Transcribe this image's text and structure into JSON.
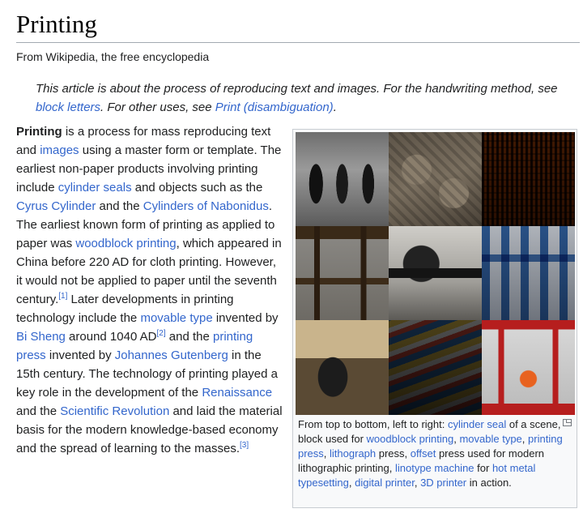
{
  "article": {
    "title": "Printing",
    "tagline": "From Wikipedia, the free encyclopedia"
  },
  "hatnote": {
    "t1": "This article is about the process of reproducing text and images. For the handwriting method, see ",
    "l1": "block letters",
    "t2": ". For other uses, see ",
    "l2": "Print (disambiguation)",
    "t3": "."
  },
  "lead": [
    "Printing",
    " is a process for mass reproducing text and ",
    "images",
    " using a master form or template. The earliest non-paper products involving printing include ",
    "cylinder seals",
    " and objects such as the ",
    "Cyrus Cylinder",
    " and the ",
    "Cylinders of Nabonidus",
    ". The earliest known form of printing as applied to paper was ",
    "woodblock printing",
    ", which appeared in China before 220 AD for cloth printing. However, it would not be applied to paper until the seventh century.",
    "[1]",
    " Later developments in printing technology include the ",
    "movable type",
    " invented by ",
    "Bi Sheng",
    " around 1040 AD",
    "[2]",
    " and the ",
    "printing press",
    " invented by ",
    "Johannes Gutenberg",
    " in the 15th century. The technology of printing played a key role in the development of the ",
    "Renaissance",
    " and the ",
    "Scientific Revolution",
    " and laid the material basis for the modern knowledge-based economy and the spread of learning to the masses.",
    "[3]"
  ],
  "caption": [
    "From top to bottom, left to right: ",
    "cylinder seal",
    " of a scene, block used for ",
    "woodblock printing",
    ", ",
    "movable type",
    ", ",
    "printing press",
    ", ",
    "lithograph",
    " press, ",
    "offset",
    " press used for modern lithographic printing, ",
    "linotype machine",
    " for ",
    "hot metal typesetting",
    ", ",
    "digital printer",
    ", ",
    "3D printer",
    " in action."
  ],
  "icons": {
    "enlarge": "enlarge-icon"
  },
  "colors": {
    "link": "#3366cc",
    "text": "#202122",
    "infobox_bg": "#f8f9fa",
    "border": "#a2a9b1"
  }
}
